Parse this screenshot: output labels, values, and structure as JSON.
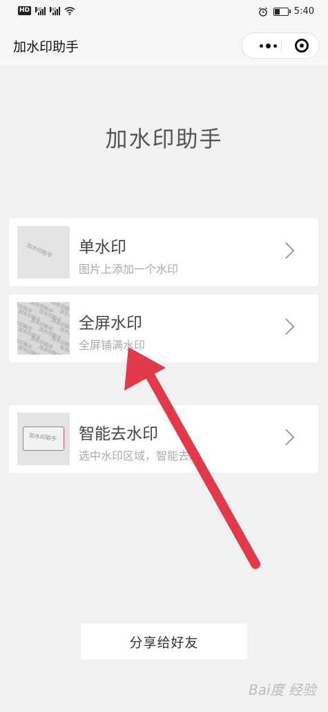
{
  "status_bar": {
    "hd_badge": "HD",
    "network_1": "4G",
    "network_2": "4G",
    "time": "5:40",
    "battery_level": 0.35
  },
  "nav": {
    "title": "加水印助手",
    "more_icon": "more-dots-icon",
    "close_icon": "target-close-icon"
  },
  "page": {
    "heading": "加水印助手"
  },
  "cards": [
    {
      "title": "单水印",
      "subtitle": "图片上添加一个水印",
      "thumb_text": "加水印助手",
      "icon": "single-watermark-thumb"
    },
    {
      "title": "全屏水印",
      "subtitle": "全屏铺满水印",
      "thumb_text": "加水印助手",
      "icon": "fullscreen-watermark-thumb"
    },
    {
      "title": "智能去水印",
      "subtitle": "选中水印区域，智能去除",
      "thumb_text": "加水印助手",
      "icon": "remove-watermark-thumb"
    }
  ],
  "share_button": "分享给好友",
  "watermark_logo": "Bai度 经验",
  "colors": {
    "arrow": "#e23a4b",
    "box_border": "#e05b73",
    "background": "#f1f1f1"
  }
}
